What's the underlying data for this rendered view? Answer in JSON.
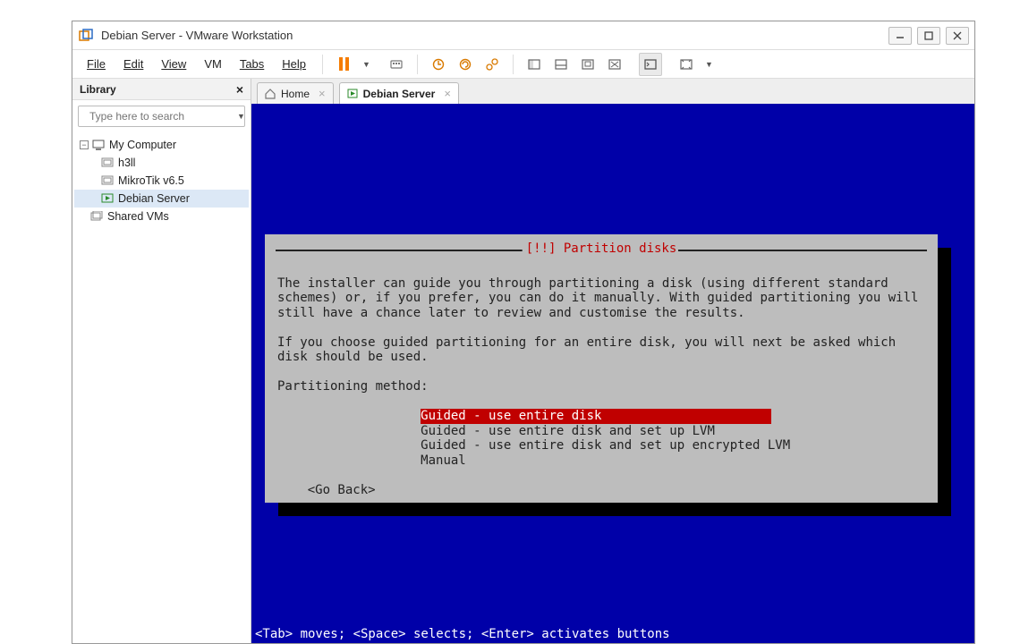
{
  "window": {
    "title": "Debian Server - VMware Workstation"
  },
  "menu": {
    "file": "File",
    "edit": "Edit",
    "view": "View",
    "vm": "VM",
    "tabs": "Tabs",
    "help": "Help"
  },
  "sidebar": {
    "header": "Library",
    "search_placeholder": "Type here to search",
    "root": "My Computer",
    "items": [
      "h3ll",
      "MikroTik v6.5",
      "Debian Server"
    ],
    "shared": "Shared VMs"
  },
  "tabs": {
    "home": "Home",
    "vm": "Debian Server"
  },
  "installer": {
    "title": "[!!] Partition disks",
    "para1": "The installer can guide you through partitioning a disk (using different standard schemes) or, if you prefer, you can do it manually. With guided partitioning you will still have a chance later to review and customise the results.",
    "para2": "If you choose guided partitioning for an entire disk, you will next be asked which disk should be used.",
    "prompt": "Partitioning method:",
    "options": [
      "Guided - use entire disk",
      "Guided - use entire disk and set up LVM",
      "Guided - use entire disk and set up encrypted LVM",
      "Manual"
    ],
    "back": "<Go Back>",
    "status": "<Tab> moves; <Space> selects; <Enter> activates buttons"
  }
}
